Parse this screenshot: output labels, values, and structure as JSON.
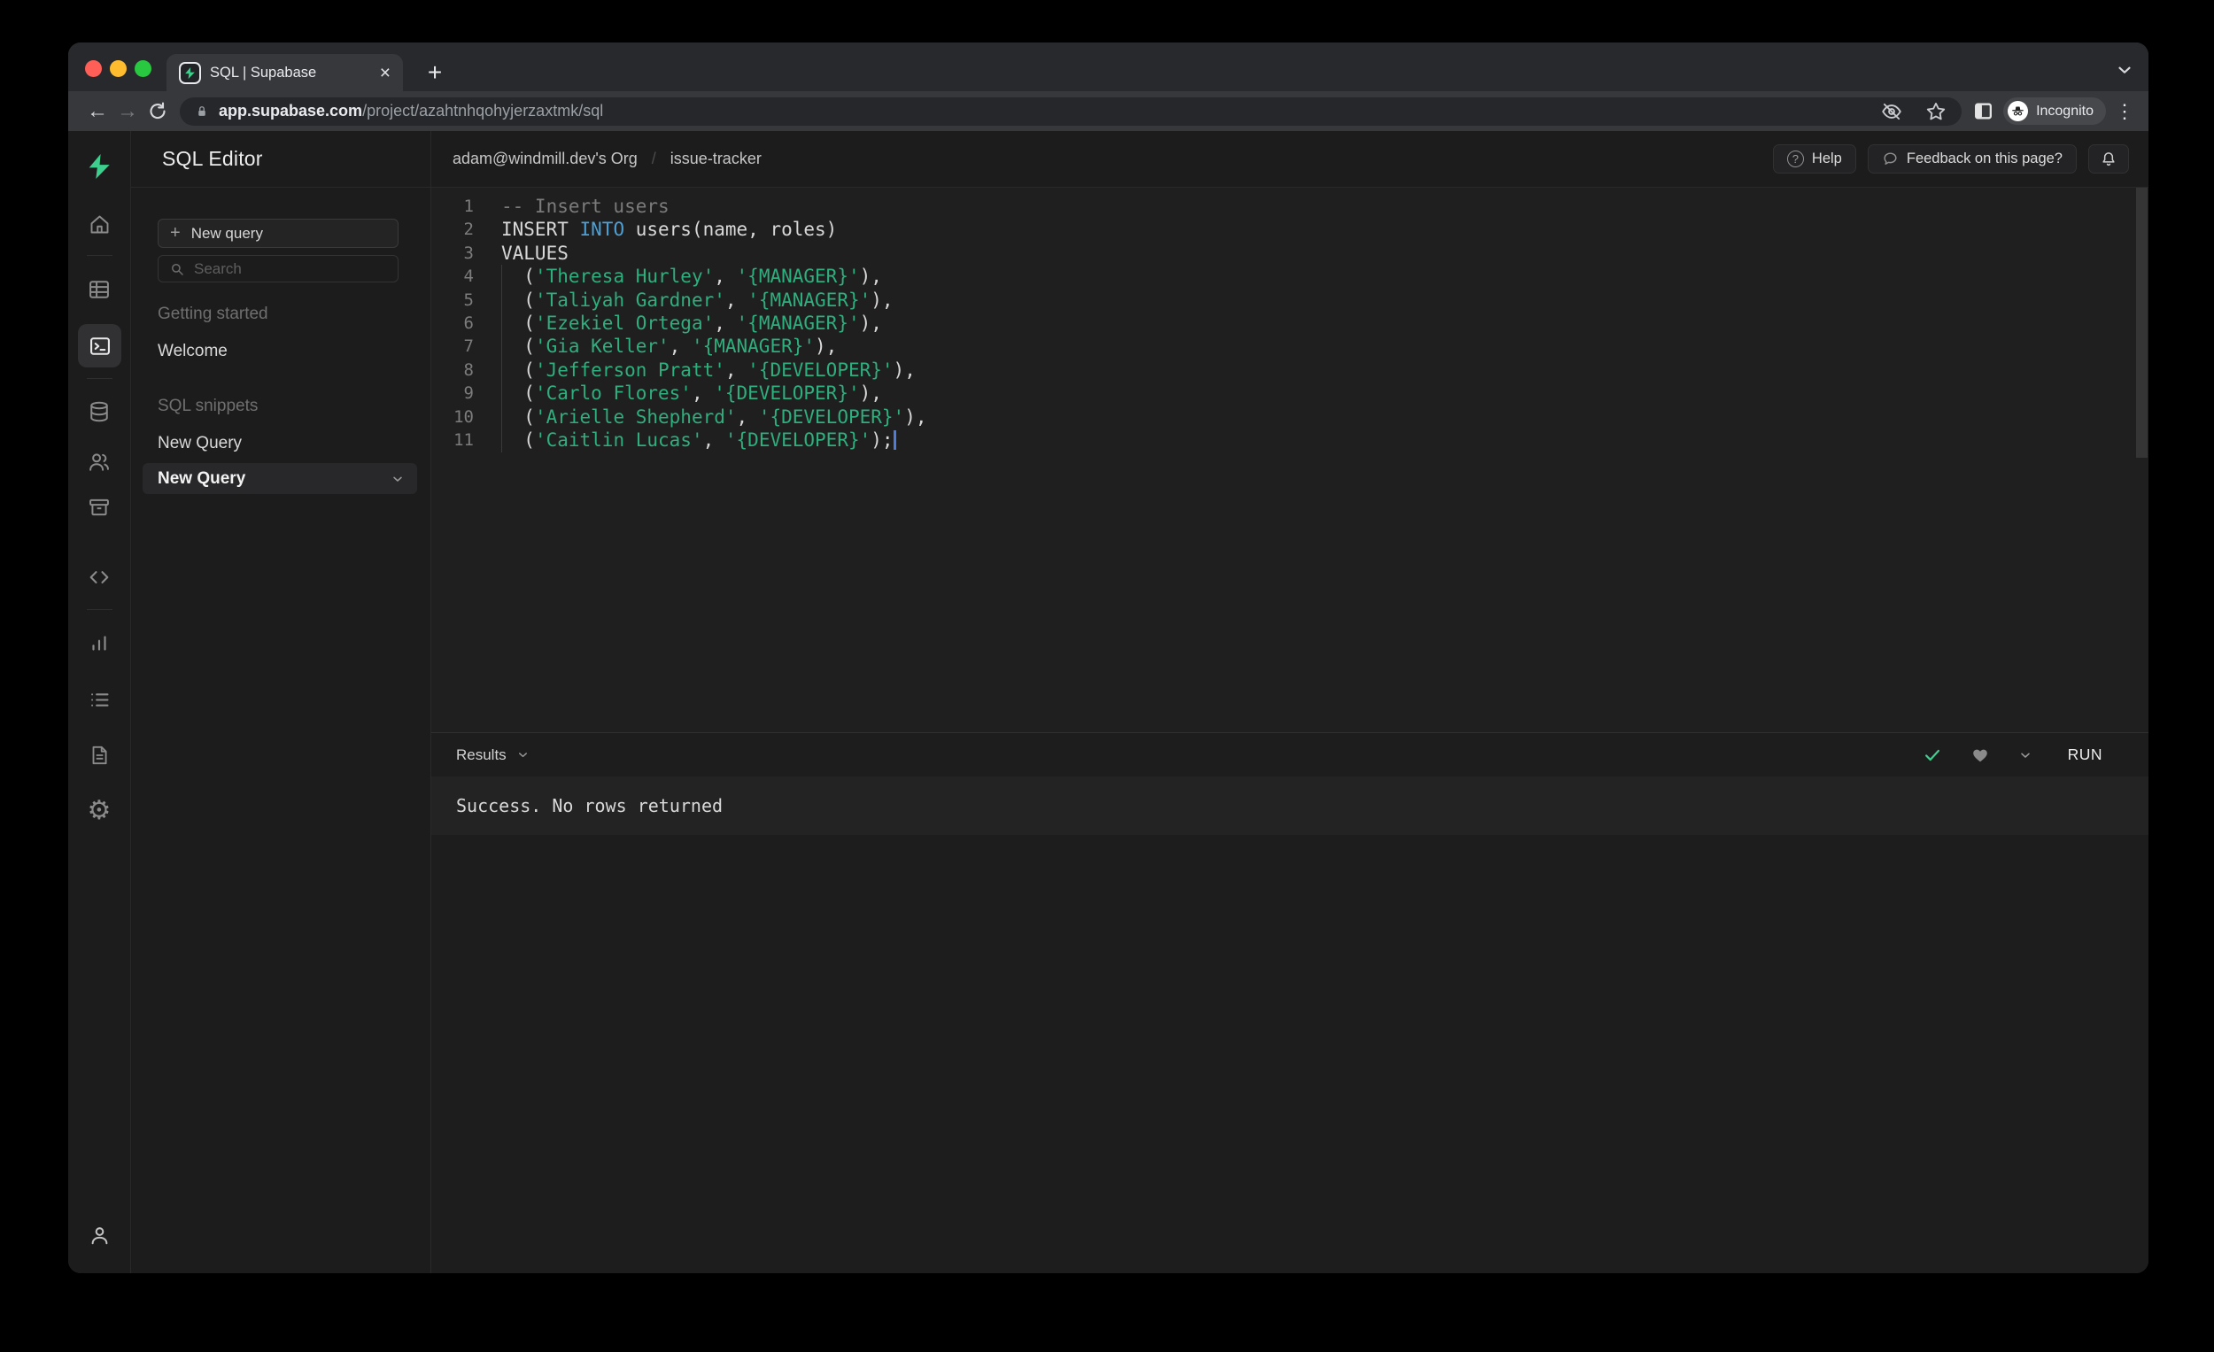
{
  "browser": {
    "tab": {
      "title": "SQL | Supabase"
    },
    "url": {
      "domain": "app.supabase.com",
      "path": "/project/azahtnhqohyjerzaxtmk/sql"
    },
    "incognito_label": "Incognito"
  },
  "icons": {
    "plus": "+",
    "close": "×",
    "kebab": "⋮",
    "back_arrow": "←",
    "forward_arrow": "→",
    "question": "?",
    "gear": "⚙"
  },
  "header": {
    "app_title": "SQL Editor",
    "breadcrumb": {
      "org": "adam@windmill.dev's Org",
      "separator": "/",
      "project": "issue-tracker"
    },
    "help_label": "Help",
    "feedback_label": "Feedback on this page?"
  },
  "nav": {
    "new_query_button": "New query",
    "search_placeholder": "Search",
    "section_getting_started": "Getting started",
    "item_welcome": "Welcome",
    "section_sql_snippets": "SQL snippets",
    "item_new_query": "New Query",
    "item_new_query_selected": "New Query"
  },
  "editor": {
    "lines": [
      {
        "n": 1,
        "tokens": [
          {
            "c": "comment",
            "t": "-- Insert users"
          }
        ]
      },
      {
        "n": 2,
        "tokens": [
          {
            "c": "plain",
            "t": "INSERT "
          },
          {
            "c": "keyword",
            "t": "INTO"
          },
          {
            "c": "plain",
            "t": " users(name, roles)"
          }
        ]
      },
      {
        "n": 3,
        "tokens": [
          {
            "c": "plain",
            "t": "VALUES"
          }
        ]
      },
      {
        "n": 4,
        "tokens": [
          {
            "c": "plain",
            "t": "  ("
          },
          {
            "c": "string",
            "t": "'Theresa Hurley'"
          },
          {
            "c": "plain",
            "t": ", "
          },
          {
            "c": "string",
            "t": "'{MANAGER}'"
          },
          {
            "c": "plain",
            "t": "),"
          }
        ]
      },
      {
        "n": 5,
        "tokens": [
          {
            "c": "plain",
            "t": "  ("
          },
          {
            "c": "string",
            "t": "'Taliyah Gardner'"
          },
          {
            "c": "plain",
            "t": ", "
          },
          {
            "c": "string",
            "t": "'{MANAGER}'"
          },
          {
            "c": "plain",
            "t": "),"
          }
        ]
      },
      {
        "n": 6,
        "tokens": [
          {
            "c": "plain",
            "t": "  ("
          },
          {
            "c": "string",
            "t": "'Ezekiel Ortega'"
          },
          {
            "c": "plain",
            "t": ", "
          },
          {
            "c": "string",
            "t": "'{MANAGER}'"
          },
          {
            "c": "plain",
            "t": "),"
          }
        ]
      },
      {
        "n": 7,
        "tokens": [
          {
            "c": "plain",
            "t": "  ("
          },
          {
            "c": "string",
            "t": "'Gia Keller'"
          },
          {
            "c": "plain",
            "t": ", "
          },
          {
            "c": "string",
            "t": "'{MANAGER}'"
          },
          {
            "c": "plain",
            "t": "),"
          }
        ]
      },
      {
        "n": 8,
        "tokens": [
          {
            "c": "plain",
            "t": "  ("
          },
          {
            "c": "string",
            "t": "'Jefferson Pratt'"
          },
          {
            "c": "plain",
            "t": ", "
          },
          {
            "c": "string",
            "t": "'{DEVELOPER}'"
          },
          {
            "c": "plain",
            "t": "),"
          }
        ]
      },
      {
        "n": 9,
        "tokens": [
          {
            "c": "plain",
            "t": "  ("
          },
          {
            "c": "string",
            "t": "'Carlo Flores'"
          },
          {
            "c": "plain",
            "t": ", "
          },
          {
            "c": "string",
            "t": "'{DEVELOPER}'"
          },
          {
            "c": "plain",
            "t": "),"
          }
        ]
      },
      {
        "n": 10,
        "tokens": [
          {
            "c": "plain",
            "t": "  ("
          },
          {
            "c": "string",
            "t": "'Arielle Shepherd'"
          },
          {
            "c": "plain",
            "t": ", "
          },
          {
            "c": "string",
            "t": "'{DEVELOPER}'"
          },
          {
            "c": "plain",
            "t": "),"
          }
        ]
      },
      {
        "n": 11,
        "caret": true,
        "tokens": [
          {
            "c": "plain",
            "t": "  ("
          },
          {
            "c": "string",
            "t": "'Caitlin Lucas'"
          },
          {
            "c": "plain",
            "t": ", "
          },
          {
            "c": "string",
            "t": "'{DEVELOPER}'"
          },
          {
            "c": "plain",
            "t": ");"
          }
        ]
      }
    ]
  },
  "results": {
    "label": "Results",
    "run_label": "RUN",
    "status": "Success. No rows returned"
  },
  "colors": {
    "accent": "#3ecf8e",
    "code_string": "#2fae7e",
    "code_keyword": "#4e9fd4",
    "code_comment": "#7b7b7b",
    "traffic_red": "#ff5f57",
    "traffic_yellow": "#febc2e",
    "traffic_green": "#28c840"
  }
}
